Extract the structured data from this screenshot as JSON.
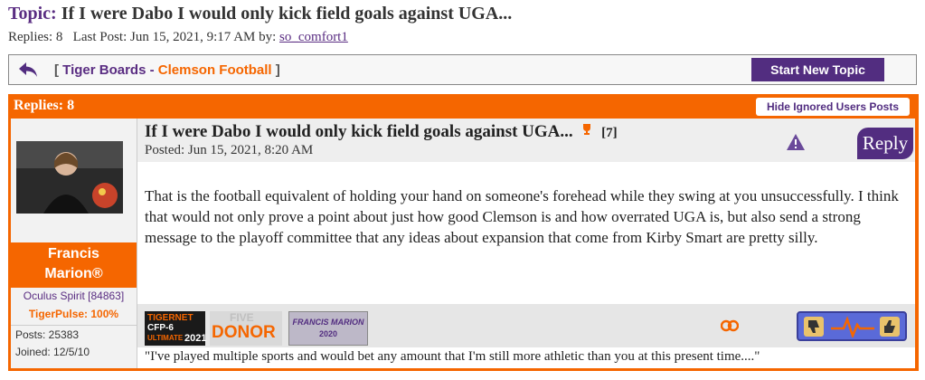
{
  "topic": {
    "prefix": "Topic:",
    "title": "If I were Dabo I would only kick field goals against UGA...",
    "replies_text": "Replies: 8",
    "last_post_text": "Last Post: Jun 15, 2021, 9:17 AM by:",
    "last_post_user": "so_comfort1"
  },
  "nav": {
    "open_bracket": "[",
    "board": "Tiger Boards",
    "separator": "-",
    "forum": "Clemson Football",
    "close_bracket": "]",
    "start_new_topic": "Start New Topic"
  },
  "thread": {
    "replies_label": "Replies: 8",
    "hide_ignored": "Hide Ignored Users Posts"
  },
  "post": {
    "title": "If I were Dabo I would only kick field goals against UGA...",
    "trophy_count": "[7]",
    "posted": "Posted: Jun 15, 2021, 8:20 AM",
    "reply_label": "Reply",
    "body": "That is the football equivalent of holding your hand on someone's forehead while they swing at you unsuccessfully. I think that would not only prove a point about just how good Clemson is and how overrated UGA is, but also send a strong message to the playoff committee that any ideas about expansion that come from Kirby Smart are pretty silly.",
    "signature": "\"I've played multiple sports and would bet any amount that I'm still more athletic than you at this present time....\""
  },
  "user": {
    "name_line1": "Francis",
    "name_line2": "Marion®",
    "title": "Oculus Spirit [84863]",
    "tiger_pulse": "TigerPulse: 100%",
    "posts": "Posts: 25383",
    "joined": "Joined: 12/5/10"
  },
  "badges": {
    "tigernet_line1": "TIGERNET",
    "tigernet_line2": "CFP-6",
    "tigernet_line3": "ULTIMATE",
    "tigernet_year": "2021",
    "donor_top": "FIVE",
    "donor_main": "DONOR",
    "francis_name": "FRANCIS MARION",
    "francis_year": "2020"
  },
  "colors": {
    "purple": "#522d80",
    "orange": "#f56600"
  }
}
